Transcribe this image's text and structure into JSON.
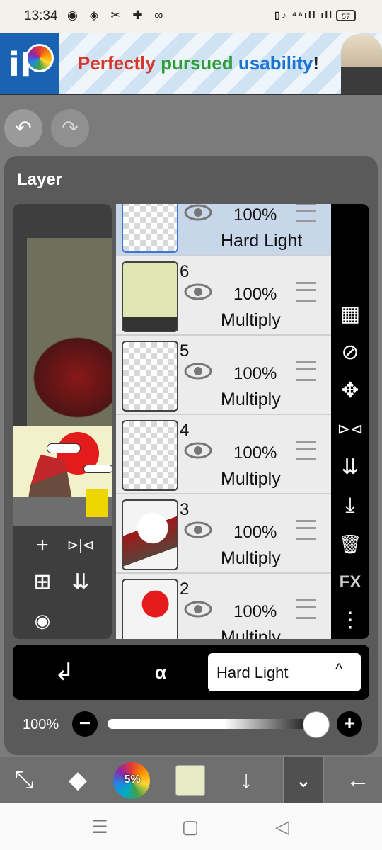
{
  "status_bar": {
    "time": "13:34",
    "notification_icons": [
      "discord-icon",
      "messenger-icon",
      "tools-icon",
      "add-user-icon",
      "meta-icon"
    ],
    "notif_glyphs": "◉ ◈ ✂ ✚ ∞",
    "system_text": "▯♪ ⁴⁶ıll ıll",
    "battery": "57"
  },
  "ad": {
    "logo_text": "iP",
    "slogan": {
      "w1": "Perfectly",
      "w2": "pursued",
      "w3": "usability",
      "w4": "!"
    }
  },
  "toolbar": {
    "undo": "↶",
    "redo": "↷"
  },
  "panel": {
    "title": "Layer",
    "preview_tools": {
      "add": "+",
      "flip": "⊳|⊲",
      "duplicate": "⊞",
      "merge": "⇊",
      "camera": "◉"
    }
  },
  "layers": [
    {
      "number": "",
      "opacity": "100%",
      "blend": "Hard Light",
      "selected": true
    },
    {
      "number": "6",
      "opacity": "100%",
      "blend": "Multiply",
      "selected": false
    },
    {
      "number": "5",
      "opacity": "100%",
      "blend": "Multiply",
      "selected": false
    },
    {
      "number": "4",
      "opacity": "100%",
      "blend": "Multiply",
      "selected": false
    },
    {
      "number": "3",
      "opacity": "100%",
      "blend": "Multiply",
      "selected": false
    },
    {
      "number": "2",
      "opacity": "100%",
      "blend": "Multiply",
      "selected": false
    }
  ],
  "right_tools": {
    "transparency": "▦",
    "clip": "⊘",
    "move": "✥",
    "flip": "⊳⊲",
    "merge_down": "⇊",
    "download": "⤓",
    "delete": "🗑",
    "fx": "FX",
    "more": "⋮"
  },
  "bottom_bar": {
    "clipping_icon": "↲",
    "lock_alpha_icon": "α",
    "blend_mode": "Hard Light",
    "chevron": "^"
  },
  "opacity": {
    "label": "100%",
    "value": 1.0,
    "minus": "−",
    "plus": "+"
  },
  "app_tools": {
    "transform": "⤡",
    "eraser": "◆",
    "brush_size": "5%",
    "down": "↓",
    "expand": "⌄",
    "back": "←"
  },
  "nav": {
    "recent": "☰",
    "home": "▢",
    "back": "◁"
  },
  "colors": {
    "panel": "#5a5a5a",
    "selected_layer": "#c8d6ea",
    "accent_red": "#e31b1b"
  }
}
